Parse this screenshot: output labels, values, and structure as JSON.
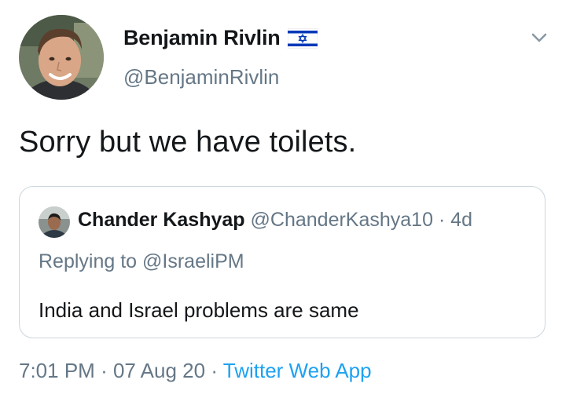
{
  "author": {
    "display_name": "Benjamin Rivlin",
    "handle": "@BenjaminRivlin",
    "flag_icon": "israel-flag-icon"
  },
  "tweet": {
    "text": "Sorry but we have toilets."
  },
  "quoted_tweet": {
    "display_name": "Chander Kashyap",
    "handle": "@ChanderKashya10",
    "separator": "·",
    "time": "4d",
    "replying_prefix": "Replying to",
    "replying_to": "@IsraeliPM",
    "text": "India and Israel problems are same"
  },
  "meta": {
    "time": "7:01 PM",
    "separator1": "·",
    "date": "07 Aug 20",
    "separator2": "·",
    "source": "Twitter Web App"
  },
  "colors": {
    "text": "#14171a",
    "secondary": "#657786",
    "link": "#1da1f2",
    "border": "#ccd6dd"
  }
}
